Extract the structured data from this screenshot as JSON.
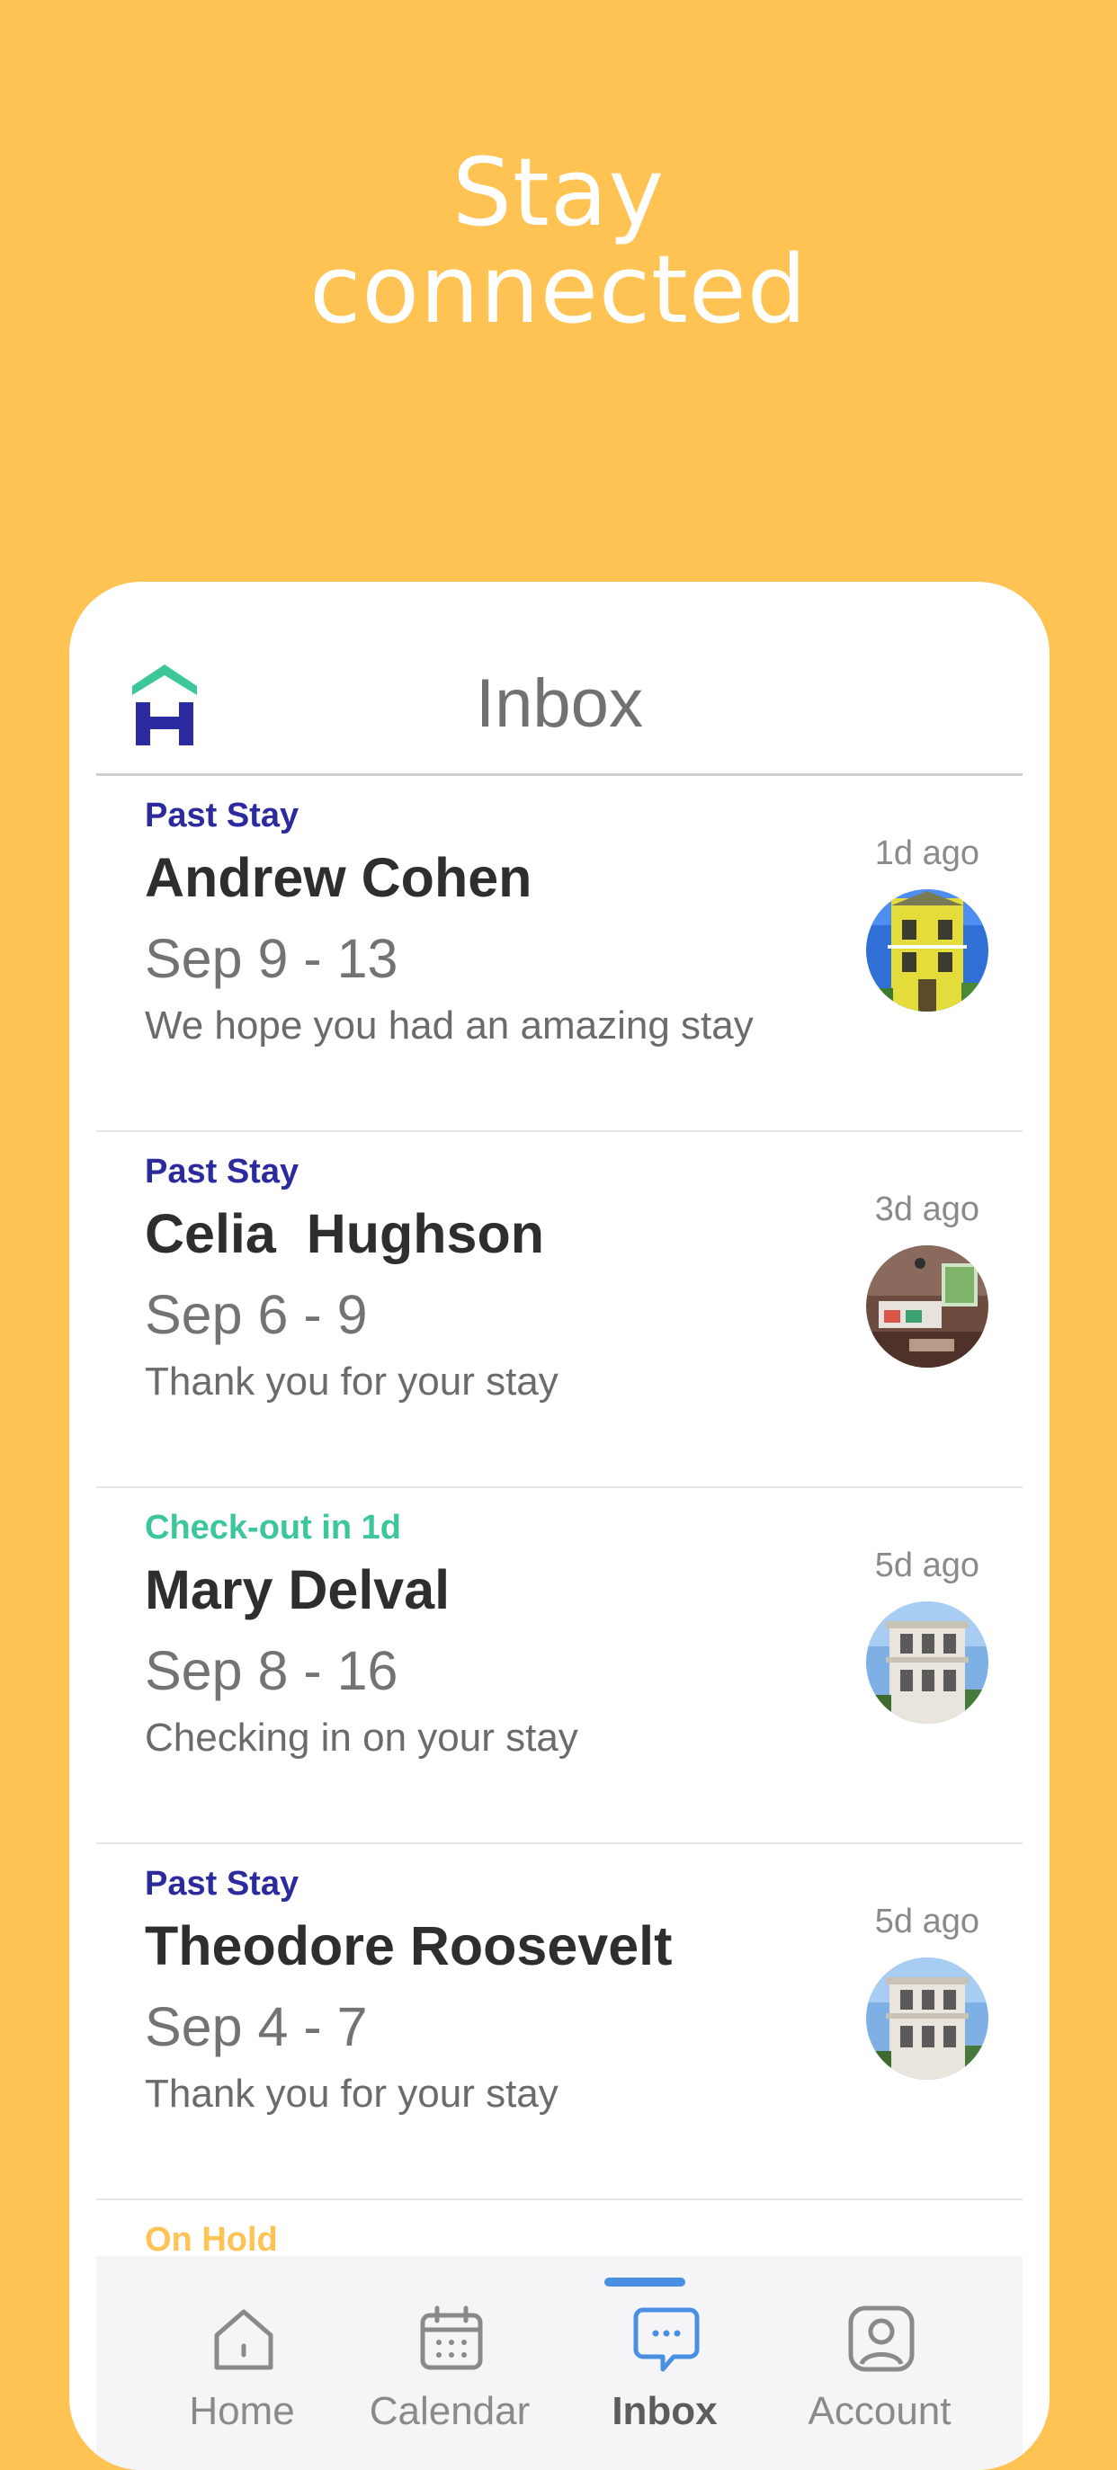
{
  "headline": {
    "line1": "Stay",
    "line2": "connected"
  },
  "inbox": {
    "title": "Inbox",
    "logo_icon": "house-h-logo-icon"
  },
  "messages": [
    {
      "status": "Past Stay",
      "status_color": "#2B2A9E",
      "name": "Andrew Cohen",
      "dates": "Sep 9 - 13",
      "preview": "We hope you had an amazing stay",
      "time": "1d ago",
      "thumb": "yellow-house-photo"
    },
    {
      "status": "Past Stay",
      "status_color": "#2B2A9E",
      "name": "Celia  Hughson",
      "dates": "Sep 6 - 9",
      "preview": "Thank you for your stay",
      "time": "3d ago",
      "thumb": "living-room-photo"
    },
    {
      "status": "Check-out in 1d",
      "status_color": "#3CC79B",
      "name": "Mary Delval",
      "dates": "Sep 8 - 16",
      "preview": "Checking in on your stay",
      "time": "5d ago",
      "thumb": "white-mansion-photo"
    },
    {
      "status": "Past Stay",
      "status_color": "#2B2A9E",
      "name": "Theodore Roosevelt",
      "dates": "Sep 4 - 7",
      "preview": "Thank you for your stay",
      "time": "5d ago",
      "thumb": "white-mansion-photo"
    },
    {
      "status": "On Hold",
      "status_color": "#FFC354"
    }
  ],
  "tabs": [
    {
      "label": "Home",
      "icon": "home-icon",
      "active": false
    },
    {
      "label": "Calendar",
      "icon": "calendar-icon",
      "active": false
    },
    {
      "label": "Inbox",
      "icon": "chat-bubble-icon",
      "active": true
    },
    {
      "label": "Account",
      "icon": "account-icon",
      "active": false
    }
  ],
  "colors": {
    "background": "#FFC354",
    "brand_navy": "#2B2A9E",
    "brand_green": "#3CC79B",
    "tab_active": "#4A90E2",
    "tab_inactive": "#8A8A8A"
  }
}
